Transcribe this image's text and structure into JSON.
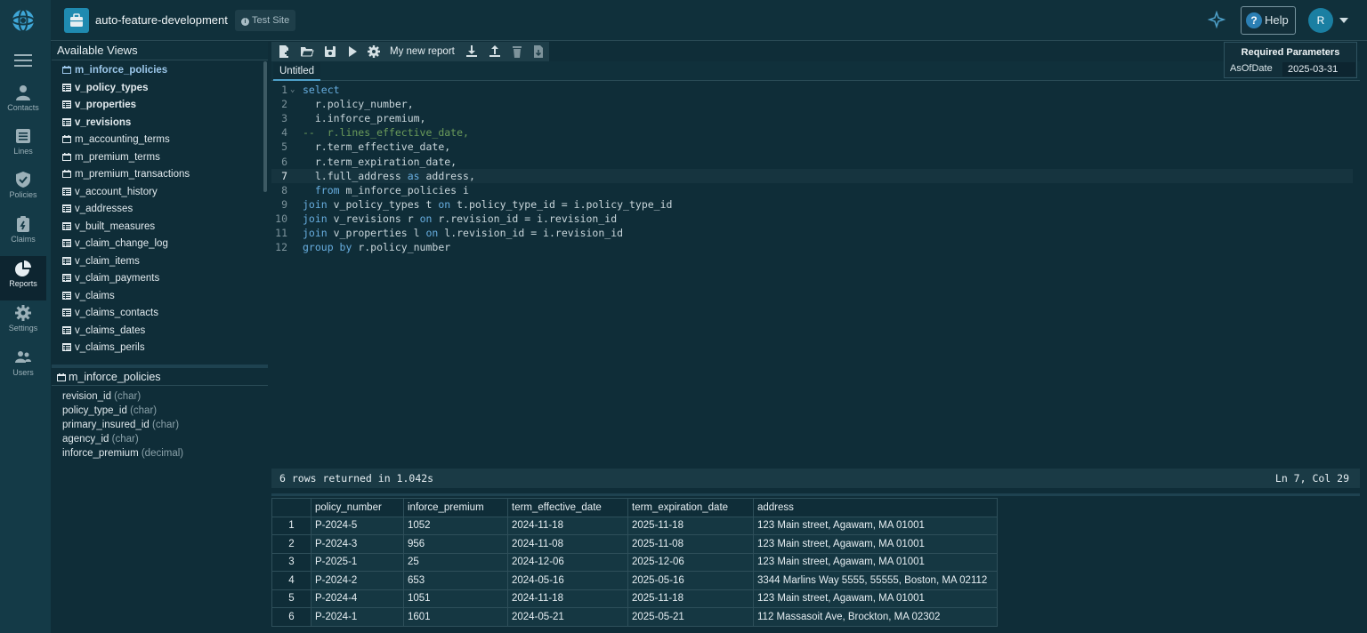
{
  "app": {
    "project_name": "auto-feature-development",
    "site_badge": "Test Site",
    "help_label": "Help",
    "avatar_initial": "R"
  },
  "nav": {
    "items": [
      {
        "label": "Contacts",
        "icon": "person-icon"
      },
      {
        "label": "Lines",
        "icon": "list-icon"
      },
      {
        "label": "Policies",
        "icon": "shield-icon"
      },
      {
        "label": "Claims",
        "icon": "claims-icon"
      },
      {
        "label": "Reports",
        "icon": "pie-chart-icon",
        "active": true
      },
      {
        "label": "Settings",
        "icon": "gear-icon"
      },
      {
        "label": "Users",
        "icon": "users-icon"
      }
    ]
  },
  "views": {
    "title": "Available Views",
    "items": [
      {
        "name": "m_inforce_policies",
        "kind": "materialized",
        "style": "selected"
      },
      {
        "name": "v_policy_types",
        "kind": "view",
        "style": "bold"
      },
      {
        "name": "v_properties",
        "kind": "view",
        "style": "bold"
      },
      {
        "name": "v_revisions",
        "kind": "view",
        "style": "bold"
      },
      {
        "name": "m_accounting_terms",
        "kind": "materialized",
        "style": "normal"
      },
      {
        "name": "m_premium_terms",
        "kind": "materialized",
        "style": "normal"
      },
      {
        "name": "m_premium_transactions",
        "kind": "materialized",
        "style": "normal"
      },
      {
        "name": "v_account_history",
        "kind": "view",
        "style": "normal"
      },
      {
        "name": "v_addresses",
        "kind": "view",
        "style": "normal"
      },
      {
        "name": "v_built_measures",
        "kind": "view",
        "style": "normal"
      },
      {
        "name": "v_claim_change_log",
        "kind": "view",
        "style": "normal"
      },
      {
        "name": "v_claim_items",
        "kind": "view",
        "style": "normal"
      },
      {
        "name": "v_claim_payments",
        "kind": "view",
        "style": "normal"
      },
      {
        "name": "v_claims",
        "kind": "view",
        "style": "normal"
      },
      {
        "name": "v_claims_contacts",
        "kind": "view",
        "style": "normal"
      },
      {
        "name": "v_claims_dates",
        "kind": "view",
        "style": "normal"
      },
      {
        "name": "v_claims_perils",
        "kind": "view",
        "style": "normal"
      }
    ]
  },
  "schema": {
    "title": "m_inforce_policies",
    "columns": [
      {
        "name": "revision_id",
        "type": "(char)"
      },
      {
        "name": "policy_type_id",
        "type": "(char)"
      },
      {
        "name": "primary_insured_id",
        "type": "(char)"
      },
      {
        "name": "agency_id",
        "type": "(char)"
      },
      {
        "name": "inforce_premium",
        "type": "(decimal)"
      }
    ]
  },
  "toolbar": {
    "report_name": "My new report"
  },
  "tabs": {
    "active": "Untitled"
  },
  "params": {
    "title": "Required Parameters",
    "name": "AsOfDate",
    "value": "2025-03-31"
  },
  "editor": {
    "active_line": 7,
    "lines": [
      [
        [
          "kw",
          "select"
        ]
      ],
      [
        [
          "",
          "  r.policy_number,"
        ]
      ],
      [
        [
          "",
          "  i.inforce_premium,"
        ]
      ],
      [
        [
          "cmt",
          "--  r.lines_effective_date,"
        ]
      ],
      [
        [
          "",
          "  r.term_effective_date,"
        ]
      ],
      [
        [
          "",
          "  r.term_expiration_date,"
        ]
      ],
      [
        [
          "",
          "  l.full_address "
        ],
        [
          "kw",
          "as"
        ],
        [
          "",
          " address,"
        ]
      ],
      [
        [
          "",
          "  "
        ],
        [
          "kw",
          "from"
        ],
        [
          "",
          " m_inforce_policies i"
        ]
      ],
      [
        [
          "kw",
          "join"
        ],
        [
          "",
          " v_policy_types t "
        ],
        [
          "kw",
          "on"
        ],
        [
          "",
          " t.policy_type_id = i.policy_type_id"
        ]
      ],
      [
        [
          "kw",
          "join"
        ],
        [
          "",
          " v_revisions r "
        ],
        [
          "kw",
          "on"
        ],
        [
          "",
          " r.revision_id = i.revision_id"
        ]
      ],
      [
        [
          "kw",
          "join"
        ],
        [
          "",
          " v_properties l "
        ],
        [
          "kw",
          "on"
        ],
        [
          "",
          " l.revision_id = i.revision_id"
        ]
      ],
      [
        [
          "kw",
          "group by"
        ],
        [
          "",
          " r.policy_number"
        ]
      ]
    ]
  },
  "status": {
    "rows_text": "6 rows returned in 1.042s",
    "cursor_text": "Ln 7, Col 29"
  },
  "results": {
    "columns": [
      "policy_number",
      "inforce_premium",
      "term_effective_date",
      "term_expiration_date",
      "address"
    ],
    "rows": [
      [
        "1",
        "P-2024-5",
        "1052",
        "2024-11-18",
        "2025-11-18",
        "123 Main street, Agawam, MA 01001"
      ],
      [
        "2",
        "P-2024-3",
        "956",
        "2024-11-08",
        "2025-11-08",
        "123 Main street, Agawam, MA 01001"
      ],
      [
        "3",
        "P-2025-1",
        "25",
        "2024-12-06",
        "2025-12-06",
        "123 Main street, Agawam, MA 01001"
      ],
      [
        "4",
        "P-2024-2",
        "653",
        "2024-05-16",
        "2025-05-16",
        "3344 Marlins Way 5555, 55555, Boston, MA 02112"
      ],
      [
        "5",
        "P-2024-4",
        "1051",
        "2024-11-18",
        "2025-11-18",
        "123 Main street, Agawam, MA 01001"
      ],
      [
        "6",
        "P-2024-1",
        "1601",
        "2024-05-21",
        "2025-05-21",
        "112 Massasoit Ave, Brockton, MA 02302"
      ]
    ]
  }
}
